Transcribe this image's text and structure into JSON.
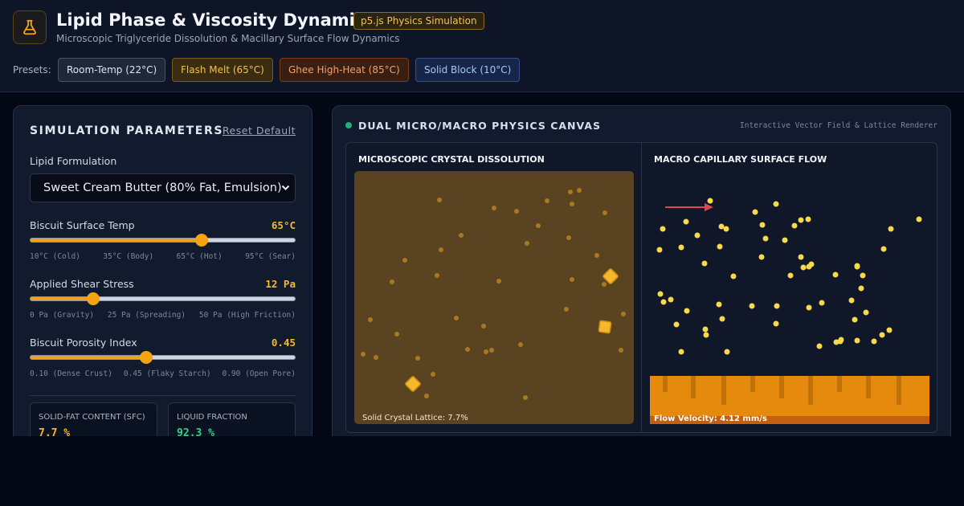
{
  "header": {
    "title": "Lipid Phase & Viscosity Dynamics",
    "badge": "p5.js Physics Simulation",
    "subtitle": "Microscopic Triglyceride Dissolution & Macillary Surface Flow Dynamics",
    "presets_label": "Presets:",
    "presets": [
      "Room-Temp (22°C)",
      "Flash Melt (65°C)",
      "Ghee High-Heat (85°C)",
      "Solid Block (10°C)"
    ]
  },
  "params": {
    "title": "SIMULATION PARAMETERS",
    "reset_label": "Reset Default",
    "formulation_label": "Lipid Formulation",
    "formulation_value": "Sweet Cream Butter (80% Fat, Emulsion)",
    "sliders": [
      {
        "label": "Biscuit Surface Temp",
        "value_text": "65°C",
        "fraction": 0.647,
        "ticks": [
          "10°C (Cold)",
          "35°C (Body)",
          "65°C (Hot)",
          "95°C (Sear)"
        ]
      },
      {
        "label": "Applied Shear Stress",
        "value_text": "12 Pa",
        "fraction": 0.24,
        "ticks": [
          "0 Pa (Gravity)",
          "25 Pa (Spreading)",
          "50 Pa (High Friction)"
        ]
      },
      {
        "label": "Biscuit Porosity Index",
        "value_text": "0.45",
        "fraction": 0.4375,
        "ticks": [
          "0.10 (Dense Crust)",
          "0.45 (Flaky Starch)",
          "0.90 (Open Pore)"
        ]
      }
    ],
    "stats": [
      {
        "label": "SOLID-FAT CONTENT (SFC)",
        "value": "7.7 %",
        "color": "#f5b92e"
      },
      {
        "label": "LIQUID FRACTION",
        "value": "92.3 %",
        "color": "#34d08c"
      }
    ]
  },
  "canvas": {
    "title": "DUAL MICRO/MACRO PHYSICS CANVAS",
    "subtitle": "Interactive Vector Field & Lattice Renderer",
    "micro_title": "MICROSCOPIC CRYSTAL DISSOLUTION",
    "macro_title": "MACRO CAPILLARY SURFACE FLOW",
    "micro_caption": "Solid Crystal Lattice: 7.7%",
    "macro_caption": "Flow Velocity: 4.12 mm/s",
    "colors": {
      "micro_bg": "#5a4320",
      "particle": "#a77a1f",
      "crystal": "#f5b82a",
      "droplet": "#f8d94a",
      "flow": "#e58a0c",
      "arrow": "#e04848"
    }
  }
}
